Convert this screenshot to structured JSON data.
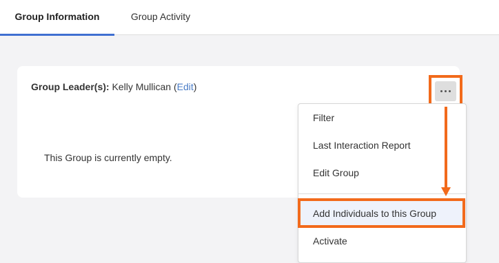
{
  "colors": {
    "accent": "#3f6fd1",
    "highlight": "#f26a1b",
    "link": "#4a7cc7"
  },
  "tabs": [
    {
      "label": "Group Information",
      "active": true
    },
    {
      "label": "Group Activity",
      "active": false
    }
  ],
  "card": {
    "leader_label": "Group Leader(s):",
    "leader_name": "Kelly Mullican",
    "open_paren": "(",
    "edit_link": "Edit",
    "close_paren": ")",
    "empty_message": "This Group is currently empty."
  },
  "more_button": {
    "icon": "more-horizontal-icon"
  },
  "menu": {
    "items": [
      {
        "label": "Filter"
      },
      {
        "label": "Last Interaction Report"
      },
      {
        "label": "Edit Group"
      },
      {
        "label": "Add Individuals to this Group",
        "highlighted": true
      },
      {
        "label": "Activate"
      }
    ]
  }
}
